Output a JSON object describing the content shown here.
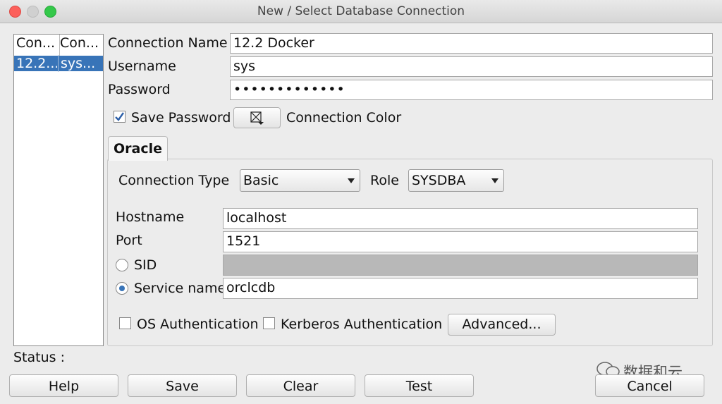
{
  "window": {
    "title": "New / Select Database Connection"
  },
  "connection_list": {
    "columns": [
      "Con...",
      "Con..."
    ],
    "rows": [
      {
        "name": "12.2...",
        "user": "sys..."
      }
    ]
  },
  "form": {
    "connection_name_label": "Connection Name",
    "connection_name_value": "12.2 Docker",
    "username_label": "Username",
    "username_value": "sys",
    "password_label": "Password",
    "password_value": "•••••••••••••",
    "save_password_label": "Save Password",
    "save_password_checked": true,
    "connection_color_label": "Connection Color"
  },
  "oracle_tab": {
    "tab_label": "Oracle",
    "connection_type_label": "Connection Type",
    "connection_type_value": "Basic",
    "role_label": "Role",
    "role_value": "SYSDBA",
    "hostname_label": "Hostname",
    "hostname_value": "localhost",
    "port_label": "Port",
    "port_value": "1521",
    "sid_label": "SID",
    "sid_value": "",
    "service_name_label": "Service name",
    "service_name_value": "orclcdb",
    "selected_mode": "service_name",
    "os_auth_label": "OS Authentication",
    "kerberos_auth_label": "Kerberos Authentication",
    "advanced_button": "Advanced..."
  },
  "status": {
    "label": "Status :"
  },
  "buttons": {
    "help": "Help",
    "save": "Save",
    "clear": "Clear",
    "test": "Test",
    "cancel": "Cancel"
  },
  "watermark": {
    "text": "数据和云"
  },
  "colors": {
    "selection": "#3874b8",
    "close": "#fc605b",
    "minimize": "#d0d0d0",
    "zoom": "#34c84a"
  }
}
